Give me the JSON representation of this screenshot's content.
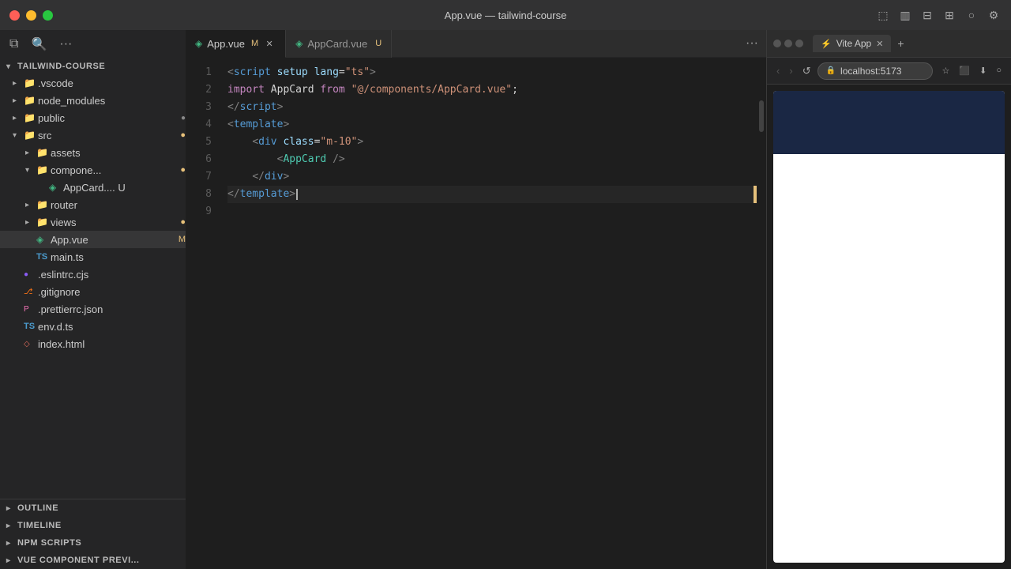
{
  "titleBar": {
    "title": "App.vue — tailwind-course",
    "controls": [
      "close",
      "minimize",
      "maximize"
    ]
  },
  "sidebar": {
    "explorerLabel": "TAILWIND-COURSE",
    "tree": [
      {
        "id": "vscode",
        "label": ".vscode",
        "type": "folder",
        "indent": 1,
        "open": false
      },
      {
        "id": "node_modules",
        "label": "node_modules",
        "type": "folder-node",
        "indent": 1,
        "open": false
      },
      {
        "id": "public",
        "label": "public",
        "type": "folder-public",
        "indent": 1,
        "open": false,
        "badge": ""
      },
      {
        "id": "src",
        "label": "src",
        "type": "folder-src",
        "indent": 1,
        "open": true,
        "badge": "●"
      },
      {
        "id": "assets",
        "label": "assets",
        "type": "folder-assets",
        "indent": 2,
        "open": false
      },
      {
        "id": "components",
        "label": "compone...",
        "type": "folder-components",
        "indent": 2,
        "open": true,
        "badge": "●"
      },
      {
        "id": "AppCard",
        "label": "AppCard.... U",
        "type": "vue",
        "indent": 3
      },
      {
        "id": "router",
        "label": "router",
        "type": "folder-router",
        "indent": 2,
        "open": false
      },
      {
        "id": "views",
        "label": "views",
        "type": "folder-views",
        "indent": 2,
        "open": false,
        "badge": "●"
      },
      {
        "id": "App.vue",
        "label": "App.vue",
        "type": "vue",
        "indent": 2,
        "badge": "M"
      },
      {
        "id": "main.ts",
        "label": "main.ts",
        "type": "ts",
        "indent": 2
      },
      {
        "id": ".eslintrc.cjs",
        "label": ".eslintrc.cjs",
        "type": "eslint",
        "indent": 1
      },
      {
        "id": ".gitignore",
        "label": ".gitignore",
        "type": "git",
        "indent": 1
      },
      {
        "id": ".prettierrc.json",
        "label": ".prettierrc.json",
        "type": "prettier",
        "indent": 1
      },
      {
        "id": "env.d.ts",
        "label": "env.d.ts",
        "type": "ts",
        "indent": 1
      },
      {
        "id": "index.html",
        "label": "index.html",
        "type": "html",
        "indent": 1
      }
    ],
    "bottomPanels": [
      {
        "id": "outline",
        "label": "OUTLINE"
      },
      {
        "id": "timeline",
        "label": "TIMELINE"
      },
      {
        "id": "npm-scripts",
        "label": "NPM SCRIPTS"
      },
      {
        "id": "vue-preview",
        "label": "VUE COMPONENT PREVI..."
      }
    ]
  },
  "tabs": [
    {
      "id": "app-vue",
      "label": "App.vue",
      "badge": "M",
      "active": true,
      "closeable": true
    },
    {
      "id": "appcard-vue",
      "label": "AppCard.vue",
      "badge": "U",
      "active": false,
      "closeable": false
    }
  ],
  "editor": {
    "lines": [
      {
        "num": 1,
        "tokens": [
          {
            "type": "tag",
            "text": "<"
          },
          {
            "type": "tag-name",
            "text": "script"
          },
          {
            "type": "plain",
            "text": " "
          },
          {
            "type": "attr-name",
            "text": "setup"
          },
          {
            "type": "plain",
            "text": " "
          },
          {
            "type": "attr-name",
            "text": "lang"
          },
          {
            "type": "plain",
            "text": "="
          },
          {
            "type": "attr-value",
            "text": "\"ts\""
          },
          {
            "type": "tag",
            "text": ">"
          }
        ]
      },
      {
        "num": 2,
        "tokens": [
          {
            "type": "keyword",
            "text": "import"
          },
          {
            "type": "plain",
            "text": " AppCard "
          },
          {
            "type": "keyword",
            "text": "from"
          },
          {
            "type": "plain",
            "text": " "
          },
          {
            "type": "string",
            "text": "\"@/components/AppCard.vue\""
          },
          {
            "type": "plain",
            "text": ";"
          }
        ]
      },
      {
        "num": 3,
        "tokens": [
          {
            "type": "tag",
            "text": "</"
          },
          {
            "type": "tag-name",
            "text": "script"
          },
          {
            "type": "tag",
            "text": ">"
          }
        ]
      },
      {
        "num": 4,
        "tokens": [
          {
            "type": "tag",
            "text": "<"
          },
          {
            "type": "tag-name",
            "text": "template"
          },
          {
            "type": "tag",
            "text": ">"
          }
        ]
      },
      {
        "num": 5,
        "tokens": [
          {
            "type": "plain",
            "text": "    "
          },
          {
            "type": "tag",
            "text": "<"
          },
          {
            "type": "tag-name",
            "text": "div"
          },
          {
            "type": "plain",
            "text": " "
          },
          {
            "type": "attr-name",
            "text": "class"
          },
          {
            "type": "plain",
            "text": "="
          },
          {
            "type": "attr-value",
            "text": "\"m-10\""
          },
          {
            "type": "tag",
            "text": ">"
          }
        ]
      },
      {
        "num": 6,
        "tokens": [
          {
            "type": "plain",
            "text": "        "
          },
          {
            "type": "tag",
            "text": "<"
          },
          {
            "type": "component",
            "text": "AppCard"
          },
          {
            "type": "plain",
            "text": " "
          },
          {
            "type": "tag",
            "text": "/>"
          }
        ]
      },
      {
        "num": 7,
        "tokens": [
          {
            "type": "plain",
            "text": "    "
          },
          {
            "type": "tag",
            "text": "</"
          },
          {
            "type": "tag-name",
            "text": "div"
          },
          {
            "type": "tag",
            "text": ">"
          }
        ]
      },
      {
        "num": 8,
        "tokens": [
          {
            "type": "tag",
            "text": "</"
          },
          {
            "type": "tag-name",
            "text": "template"
          },
          {
            "type": "tag",
            "text": ">"
          }
        ],
        "cursor": true
      },
      {
        "num": 9,
        "tokens": []
      }
    ]
  },
  "browser": {
    "tabLabel": "Vite App",
    "url": "localhost:5173",
    "backDisabled": true,
    "forwardDisabled": true
  }
}
